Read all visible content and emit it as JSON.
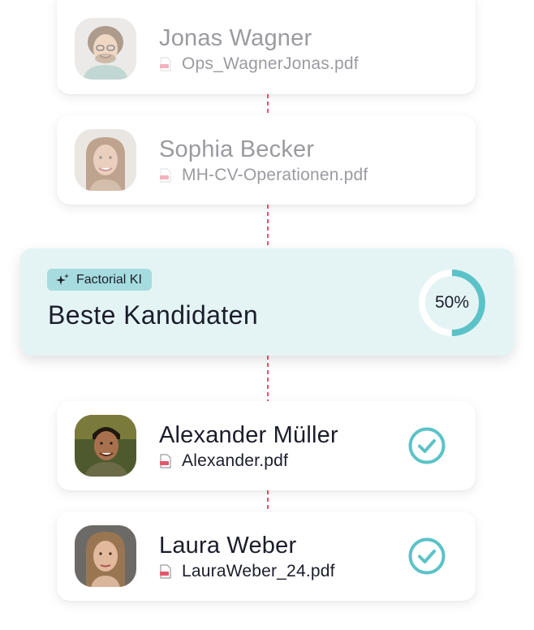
{
  "colors": {
    "accent": "#5bc3c8",
    "connector": "#e5566c",
    "panel_bg": "#e4f4f5",
    "badge_bg": "#a6dcdf",
    "text": "#1c1d2b",
    "faded_text": "#9a9ba0"
  },
  "candidates_top": [
    {
      "name": "Jonas Wagner",
      "file": "Ops_WagnerJonas.pdf"
    },
    {
      "name": "Sophia Becker",
      "file": "MH-CV-Operationen.pdf"
    }
  ],
  "ai_panel": {
    "badge_label": "Factorial KI",
    "badge_icon": "sparkle-icon",
    "title": "Beste Kandidaten",
    "progress": 0.5,
    "progress_label": "50%"
  },
  "candidates_selected": [
    {
      "name": "Alexander Müller",
      "file": "Alexander.pdf",
      "status_icon": "check-circle-icon"
    },
    {
      "name": "Laura Weber",
      "file": "LauraWeber_24.pdf",
      "status_icon": "check-circle-icon"
    }
  ]
}
